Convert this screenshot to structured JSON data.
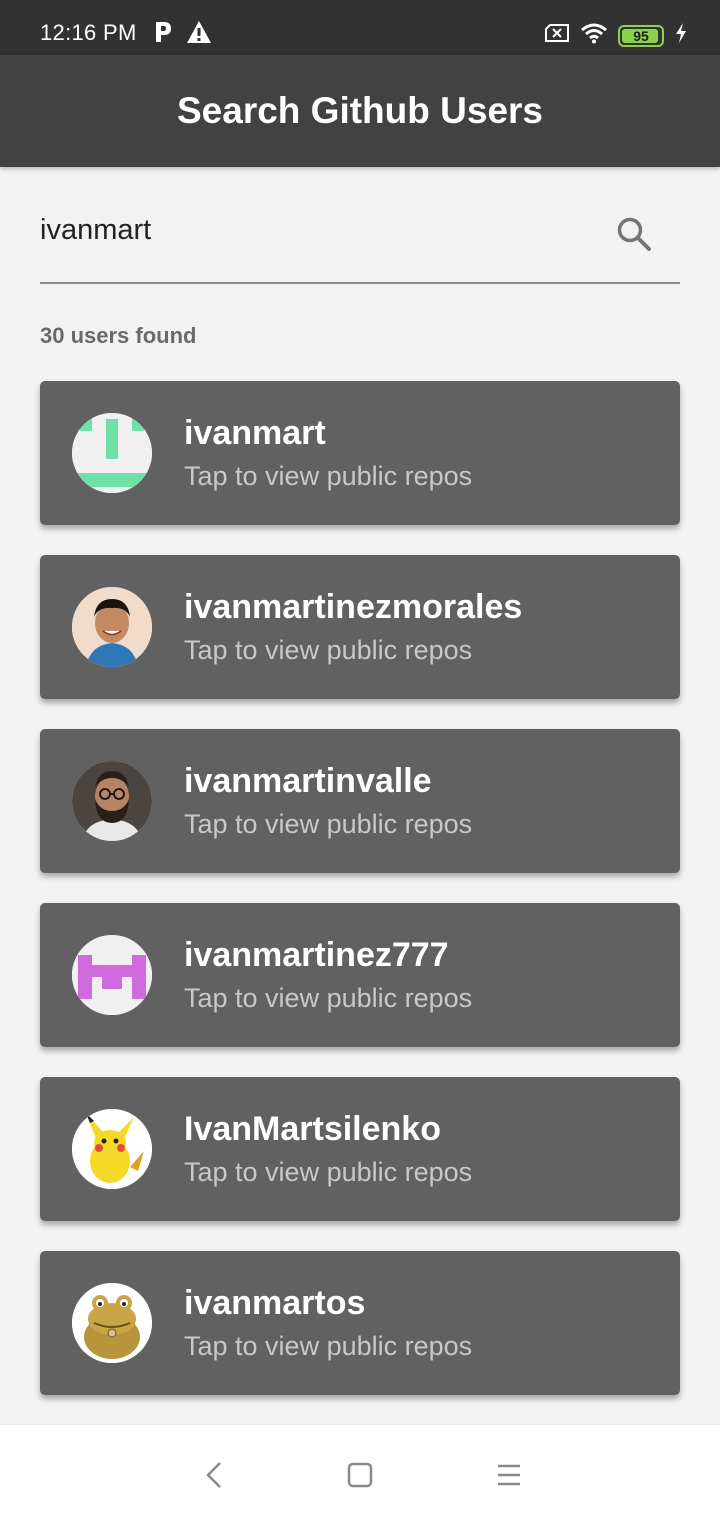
{
  "status_bar": {
    "time": "12:16 PM",
    "battery_level": "95",
    "left_icons": [
      "parking-icon",
      "warning-icon"
    ],
    "right_icons": [
      "sim-x-icon",
      "wifi-icon",
      "battery-icon",
      "charging-icon"
    ]
  },
  "app_bar": {
    "title": "Search Github Users"
  },
  "search": {
    "value": "ivanmart",
    "icon": "search-icon"
  },
  "results": {
    "count_text": "30 users found",
    "users": [
      {
        "username": "ivanmart",
        "subtitle": "Tap to view public repos",
        "avatar": "green-identicon"
      },
      {
        "username": "ivanmartinezmorales",
        "subtitle": "Tap to view public repos",
        "avatar": "smiling-man-photo"
      },
      {
        "username": "ivanmartinvalle",
        "subtitle": "Tap to view public repos",
        "avatar": "bearded-man-photo"
      },
      {
        "username": "ivanmartinez777",
        "subtitle": "Tap to view public repos",
        "avatar": "purple-identicon"
      },
      {
        "username": "IvanMartsilenko",
        "subtitle": "Tap to view public repos",
        "avatar": "pikachu-image"
      },
      {
        "username": "ivanmartos",
        "subtitle": "Tap to view public repos",
        "avatar": "toad-cartoon-image"
      }
    ]
  },
  "colors": {
    "app_bar": "#424242",
    "status_bar": "#323232",
    "card": "#616161",
    "background": "#f2f2f2",
    "identicon_green": "#6fe0a7",
    "identicon_purple": "#cf6bdc",
    "battery": "#8bd34a"
  },
  "nav_bar": {
    "icons": [
      "back-icon",
      "home-icon",
      "menu-icon"
    ]
  }
}
